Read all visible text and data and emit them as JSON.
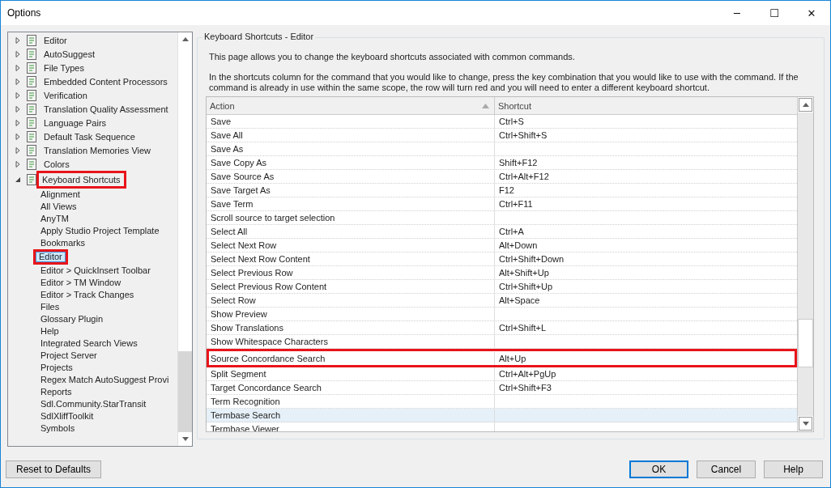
{
  "window": {
    "title": "Options",
    "controls": [
      "─",
      "☐",
      "✕"
    ]
  },
  "tree": [
    {
      "label": "Editor",
      "expanded": false,
      "highlighted": false
    },
    {
      "label": "AutoSuggest",
      "expanded": false,
      "highlighted": false
    },
    {
      "label": "File Types",
      "expanded": false,
      "highlighted": false
    },
    {
      "label": "Embedded Content Processors",
      "expanded": false,
      "highlighted": false
    },
    {
      "label": "Verification",
      "expanded": false,
      "highlighted": false
    },
    {
      "label": "Translation Quality Assessment",
      "expanded": false,
      "highlighted": false
    },
    {
      "label": "Language Pairs",
      "expanded": false,
      "highlighted": false
    },
    {
      "label": "Default Task Sequence",
      "expanded": false,
      "highlighted": false
    },
    {
      "label": "Translation Memories View",
      "expanded": false,
      "highlighted": false
    },
    {
      "label": "Colors",
      "expanded": false,
      "highlighted": false
    },
    {
      "label": "Keyboard Shortcuts",
      "expanded": true,
      "highlighted": true,
      "children": [
        {
          "label": "Alignment",
          "selected": false,
          "highlighted": false
        },
        {
          "label": "All Views",
          "selected": false,
          "highlighted": false
        },
        {
          "label": "AnyTM",
          "selected": false,
          "highlighted": false
        },
        {
          "label": "Apply Studio Project Template",
          "selected": false,
          "highlighted": false
        },
        {
          "label": "Bookmarks",
          "selected": false,
          "highlighted": false
        },
        {
          "label": "Editor",
          "selected": true,
          "highlighted": true
        },
        {
          "label": "Editor > QuickInsert Toolbar",
          "selected": false,
          "highlighted": false
        },
        {
          "label": "Editor > TM Window",
          "selected": false,
          "highlighted": false
        },
        {
          "label": "Editor > Track Changes",
          "selected": false,
          "highlighted": false
        },
        {
          "label": "Files",
          "selected": false,
          "highlighted": false
        },
        {
          "label": "Glossary Plugin",
          "selected": false,
          "highlighted": false
        },
        {
          "label": "Help",
          "selected": false,
          "highlighted": false
        },
        {
          "label": "Integrated Search Views",
          "selected": false,
          "highlighted": false
        },
        {
          "label": "Project Server",
          "selected": false,
          "highlighted": false
        },
        {
          "label": "Projects",
          "selected": false,
          "highlighted": false
        },
        {
          "label": "Regex Match AutoSuggest Provi",
          "selected": false,
          "highlighted": false
        },
        {
          "label": "Reports",
          "selected": false,
          "highlighted": false
        },
        {
          "label": "Sdl.Community.StarTransit",
          "selected": false,
          "highlighted": false
        },
        {
          "label": "SdlXliffToolkit",
          "selected": false,
          "highlighted": false
        },
        {
          "label": "Symbols",
          "selected": false,
          "highlighted": false
        }
      ]
    }
  ],
  "group_title": "Keyboard Shortcuts - Editor",
  "intro": "This page allows you to change the keyboard shortcuts associated with common commands.",
  "instructions": "In the shortcuts column for the command that you would like to change, press the key combination that you would like to use with the command.  If the command is already in use within the same scope, the row will turn red and you will need to enter a different keyboard shortcut.",
  "table": {
    "columns": [
      "Action",
      "Shortcut"
    ],
    "rows": [
      {
        "action": "Save",
        "shortcut": "Ctrl+S",
        "selected": false,
        "highlighted": false
      },
      {
        "action": "Save All",
        "shortcut": "Ctrl+Shift+S",
        "selected": false,
        "highlighted": false
      },
      {
        "action": "Save As",
        "shortcut": "",
        "selected": false,
        "highlighted": false
      },
      {
        "action": "Save Copy As",
        "shortcut": "Shift+F12",
        "selected": false,
        "highlighted": false
      },
      {
        "action": "Save Source As",
        "shortcut": "Ctrl+Alt+F12",
        "selected": false,
        "highlighted": false
      },
      {
        "action": "Save Target As",
        "shortcut": "F12",
        "selected": false,
        "highlighted": false
      },
      {
        "action": "Save Term",
        "shortcut": "Ctrl+F11",
        "selected": false,
        "highlighted": false
      },
      {
        "action": "Scroll source to target selection",
        "shortcut": "",
        "selected": false,
        "highlighted": false
      },
      {
        "action": "Select All",
        "shortcut": "Ctrl+A",
        "selected": false,
        "highlighted": false
      },
      {
        "action": "Select Next Row",
        "shortcut": "Alt+Down",
        "selected": false,
        "highlighted": false
      },
      {
        "action": "Select Next Row Content",
        "shortcut": "Ctrl+Shift+Down",
        "selected": false,
        "highlighted": false
      },
      {
        "action": "Select Previous Row",
        "shortcut": "Alt+Shift+Up",
        "selected": false,
        "highlighted": false
      },
      {
        "action": "Select Previous Row Content",
        "shortcut": "Ctrl+Shift+Up",
        "selected": false,
        "highlighted": false
      },
      {
        "action": "Select Row",
        "shortcut": "Alt+Space",
        "selected": false,
        "highlighted": false
      },
      {
        "action": "Show Preview",
        "shortcut": "",
        "selected": false,
        "highlighted": false
      },
      {
        "action": "Show Translations",
        "shortcut": "Ctrl+Shift+L",
        "selected": false,
        "highlighted": false
      },
      {
        "action": "Show Whitespace Characters",
        "shortcut": "",
        "selected": false,
        "highlighted": false
      },
      {
        "action": "Source Concordance Search",
        "shortcut": "Alt+Up",
        "selected": false,
        "highlighted": true
      },
      {
        "action": "Split Segment",
        "shortcut": "Ctrl+Alt+PgUp",
        "selected": false,
        "highlighted": false
      },
      {
        "action": "Target Concordance Search",
        "shortcut": "Ctrl+Shift+F3",
        "selected": false,
        "highlighted": false
      },
      {
        "action": "Term Recognition",
        "shortcut": "",
        "selected": false,
        "highlighted": false
      },
      {
        "action": "Termbase Search",
        "shortcut": "",
        "selected": true,
        "highlighted": false
      },
      {
        "action": "Termbase Viewer",
        "shortcut": "",
        "selected": false,
        "highlighted": false
      }
    ]
  },
  "buttons": {
    "reset": "Reset to Defaults",
    "ok": "OK",
    "cancel": "Cancel",
    "help": "Help"
  }
}
